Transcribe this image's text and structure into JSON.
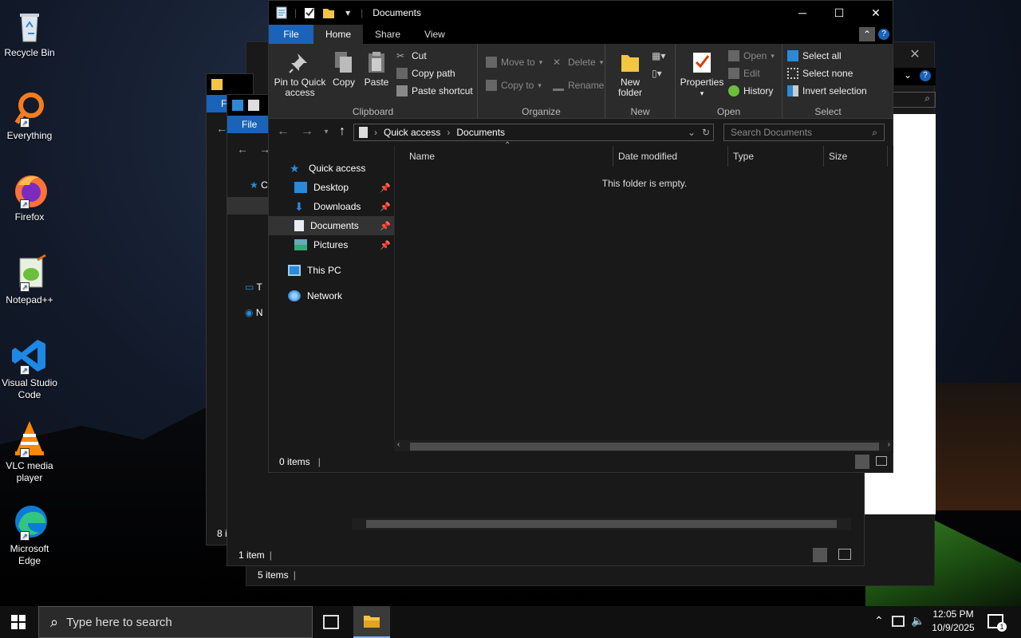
{
  "desktop": {
    "icons": [
      {
        "label": "Recycle Bin",
        "icon": "recycle-bin-icon"
      },
      {
        "label": "Everything",
        "icon": "everything-search-icon"
      },
      {
        "label": "Firefox",
        "icon": "firefox-icon"
      },
      {
        "label": "Notepad++",
        "icon": "notepad-plus-plus-icon"
      },
      {
        "label": "Visual Studio Code",
        "icon": "vscode-icon"
      },
      {
        "label": "VLC media player",
        "icon": "vlc-icon"
      },
      {
        "label": "Microsoft Edge",
        "icon": "edge-icon"
      }
    ]
  },
  "bg_windows": {
    "win1": {
      "file_tab": "F",
      "status": "8 i"
    },
    "win2": {
      "file_tab": "File",
      "status": "1 item",
      "nav_items": [
        "C",
        "T",
        "N"
      ]
    },
    "win3": {
      "status": "5 items"
    }
  },
  "window": {
    "title": "Documents",
    "tabs": [
      "File",
      "Home",
      "Share",
      "View"
    ],
    "active_tab": "Home",
    "ribbon": {
      "clipboard": {
        "label": "Clipboard",
        "pin": "Pin to Quick access",
        "copy": "Copy",
        "paste": "Paste",
        "cut": "Cut",
        "copy_path": "Copy path",
        "paste_shortcut": "Paste shortcut"
      },
      "organize": {
        "label": "Organize",
        "move_to": "Move to",
        "copy_to": "Copy to",
        "delete": "Delete",
        "rename": "Rename"
      },
      "new": {
        "label": "New",
        "new_folder": "New folder"
      },
      "open": {
        "label": "Open",
        "properties": "Properties",
        "open": "Open",
        "edit": "Edit",
        "history": "History"
      },
      "select": {
        "label": "Select",
        "select_all": "Select all",
        "select_none": "Select none",
        "invert": "Invert selection"
      }
    },
    "address": {
      "crumbs": [
        "Quick access",
        "Documents"
      ],
      "search_placeholder": "Search Documents"
    },
    "nav": {
      "quick_access": "Quick access",
      "items": [
        {
          "label": "Desktop",
          "pinned": true
        },
        {
          "label": "Downloads",
          "pinned": true
        },
        {
          "label": "Documents",
          "pinned": true,
          "selected": true
        },
        {
          "label": "Pictures",
          "pinned": true
        }
      ],
      "this_pc": "This PC",
      "network": "Network"
    },
    "columns": [
      "Name",
      "Date modified",
      "Type",
      "Size"
    ],
    "empty_text": "This folder is empty.",
    "status": "0 items"
  },
  "taskbar": {
    "search_placeholder": "Type here to search",
    "time": "12:05 PM",
    "date": "10/9/2025",
    "notification_count": "1"
  },
  "colors": {
    "accent": "#1a63b8",
    "explorer_bg": "#191919",
    "ribbon_bg": "#2b2b2b",
    "folder_yellow": "#f4c542"
  }
}
